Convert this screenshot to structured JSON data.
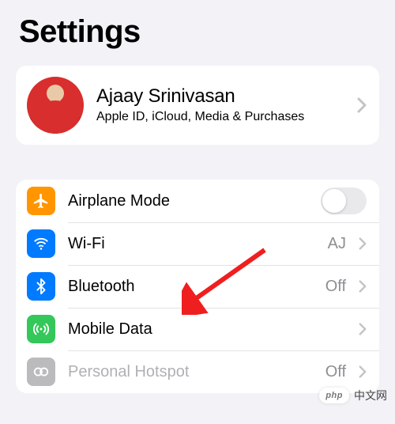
{
  "title": "Settings",
  "profile": {
    "name": "Ajaay Srinivasan",
    "subtitle": "Apple ID, iCloud, Media & Purchases"
  },
  "rows": {
    "airplane": {
      "label": "Airplane Mode"
    },
    "wifi": {
      "label": "Wi-Fi",
      "value": "AJ"
    },
    "bluetooth": {
      "label": "Bluetooth",
      "value": "Off"
    },
    "mobiledata": {
      "label": "Mobile Data"
    },
    "hotspot": {
      "label": "Personal Hotspot",
      "value": "Off"
    }
  },
  "watermark": {
    "badge": "php",
    "text": "中文网"
  }
}
